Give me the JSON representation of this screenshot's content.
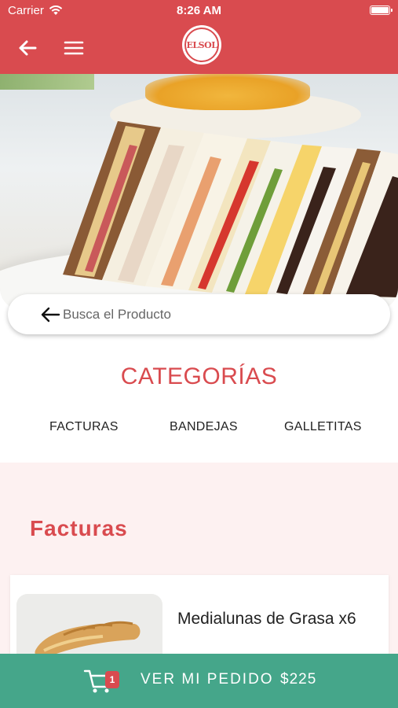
{
  "status_bar": {
    "carrier": "Carrier",
    "time": "8:26 AM"
  },
  "nav": {
    "logo_text": "ELSOL"
  },
  "search": {
    "placeholder": "Busca el Producto"
  },
  "categories": {
    "title": "CATEGORÍAS",
    "tabs": [
      {
        "label": "FACTURAS"
      },
      {
        "label": "BANDEJAS"
      },
      {
        "label": "GALLETITAS"
      }
    ]
  },
  "section": {
    "title": "Facturas",
    "products": [
      {
        "name": "Medialunas de Grasa x6"
      }
    ]
  },
  "order_bar": {
    "cart_count": "1",
    "label": "VER MI PEDIDO",
    "total": "$225"
  },
  "colors": {
    "brand": "#d94b4f",
    "order_bar": "#45a68a",
    "section_bg": "#fdf1f1"
  },
  "icons": {
    "back": "arrow-left-icon",
    "menu": "hamburger-menu-icon",
    "wifi": "wifi-icon",
    "battery": "battery-icon",
    "search_back": "arrow-left-icon",
    "cart": "shopping-cart-icon"
  }
}
